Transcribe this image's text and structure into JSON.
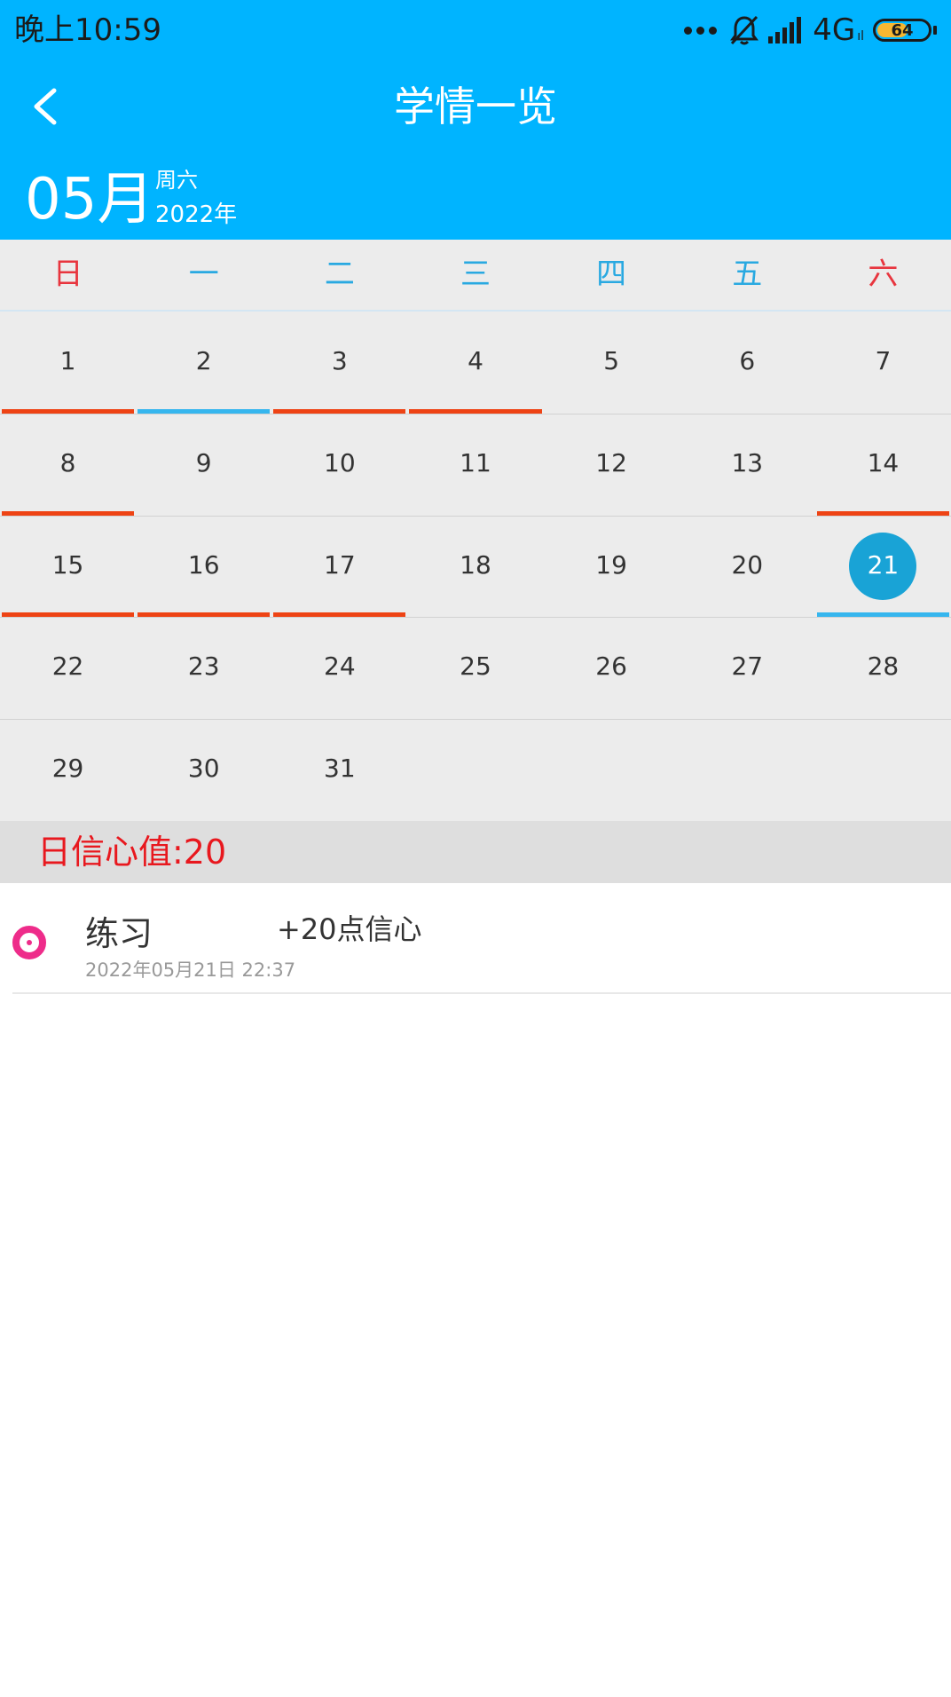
{
  "status_bar": {
    "time": "晚上10:59",
    "network": "4G",
    "network_sub": "ıl",
    "battery_level": 64,
    "battery_label": "64",
    "icons": [
      "more-dots-icon",
      "bell-muted-icon",
      "signal-icon"
    ]
  },
  "header": {
    "title": "学情一览",
    "back_icon": "chevron-left-icon"
  },
  "month_bar": {
    "month": "05月",
    "weekday": "周六",
    "year": "2022年"
  },
  "calendar": {
    "weekdays": [
      "日",
      "一",
      "二",
      "三",
      "四",
      "五",
      "六"
    ],
    "weekday_colors": [
      "#e8353e",
      "#29a9e1",
      "#29a9e1",
      "#29a9e1",
      "#29a9e1",
      "#29a9e1",
      "#e8353e"
    ],
    "leading_blanks": 0,
    "days": [
      {
        "d": "1",
        "bar": "red"
      },
      {
        "d": "2",
        "bar": "blue"
      },
      {
        "d": "3",
        "bar": "red"
      },
      {
        "d": "4",
        "bar": "red"
      },
      {
        "d": "5"
      },
      {
        "d": "6"
      },
      {
        "d": "7"
      },
      {
        "d": "8",
        "bar": "red"
      },
      {
        "d": "9"
      },
      {
        "d": "10"
      },
      {
        "d": "11"
      },
      {
        "d": "12"
      },
      {
        "d": "13"
      },
      {
        "d": "14",
        "bar": "red"
      },
      {
        "d": "15",
        "bar": "red"
      },
      {
        "d": "16",
        "bar": "red"
      },
      {
        "d": "17",
        "bar": "red"
      },
      {
        "d": "18"
      },
      {
        "d": "19"
      },
      {
        "d": "20"
      },
      {
        "d": "21",
        "bar": "blue",
        "selected": true
      },
      {
        "d": "22"
      },
      {
        "d": "23"
      },
      {
        "d": "24"
      },
      {
        "d": "25"
      },
      {
        "d": "26"
      },
      {
        "d": "27"
      },
      {
        "d": "28"
      },
      {
        "d": "29"
      },
      {
        "d": "30"
      },
      {
        "d": "31"
      }
    ],
    "bar_colors": {
      "red": "#ee4314",
      "blue": "#36b6ee"
    },
    "selected_color": "#19a3d6"
  },
  "summary": {
    "text": "日信心值:20",
    "color": "#e8181e"
  },
  "records": [
    {
      "name": "练习",
      "points": "+20点信心",
      "time": "2022年05月21日 22:37",
      "icon": "target-circle-icon",
      "icon_color": "#ee2c8a"
    }
  ]
}
